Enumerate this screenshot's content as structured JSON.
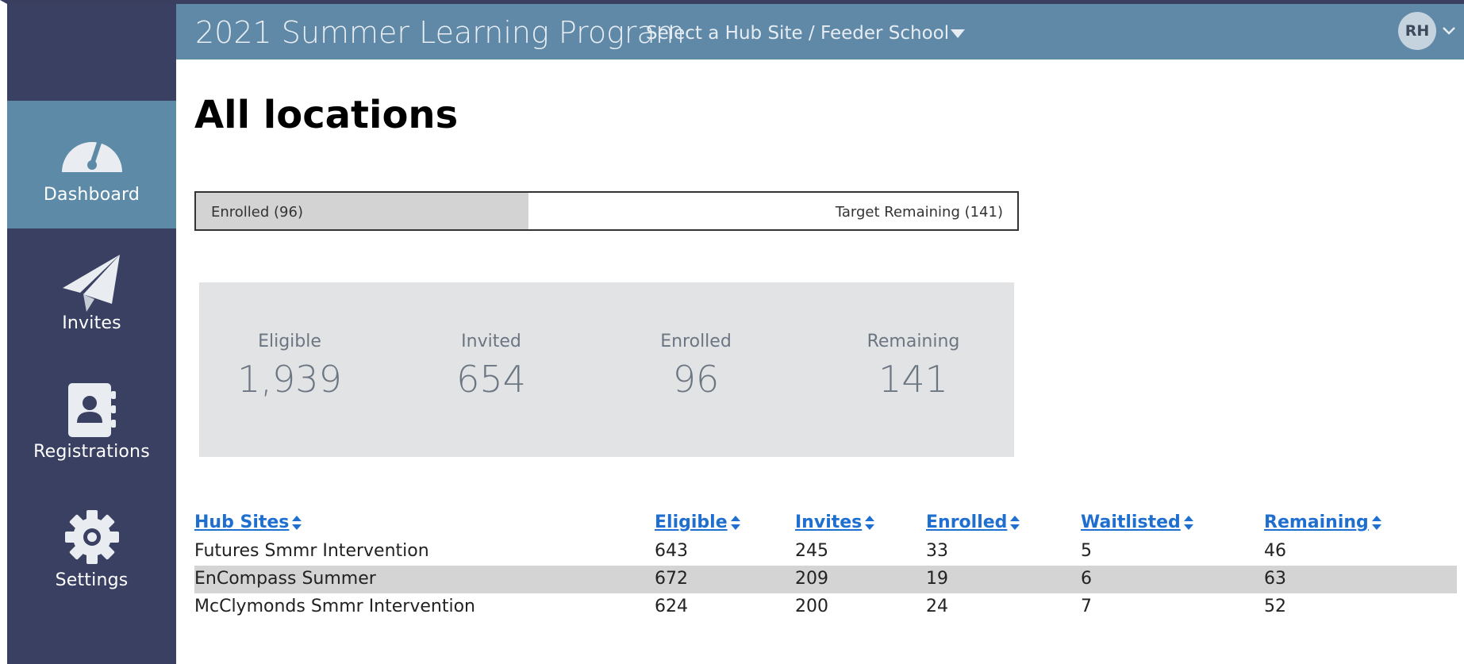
{
  "header": {
    "app_title": "2021 Summer Learning Program",
    "site_select_label": "Select a Hub Site / Feeder School",
    "user_initials": "RH"
  },
  "sidebar": {
    "items": [
      {
        "label": "Dashboard",
        "icon": "speedometer-icon",
        "active": true
      },
      {
        "label": "Invites",
        "icon": "paper-plane-icon",
        "active": false
      },
      {
        "label": "Registrations",
        "icon": "contact-book-icon",
        "active": false
      },
      {
        "label": "Settings",
        "icon": "gear-icon",
        "active": false
      }
    ]
  },
  "main": {
    "page_title": "All locations",
    "progress": {
      "enrolled_label": "Enrolled (96)",
      "remaining_label": "Target Remaining (141)",
      "enrolled_fraction": 0.405
    },
    "stats": [
      {
        "label": "Eligible",
        "value": "1,939"
      },
      {
        "label": "Invited",
        "value": "654"
      },
      {
        "label": "Enrolled",
        "value": "96"
      },
      {
        "label": "Remaining",
        "value": "141"
      }
    ],
    "table": {
      "headers": [
        "Hub Sites",
        "Eligible",
        "Invites",
        "Enrolled",
        "Waitlisted",
        "Remaining"
      ],
      "rows": [
        [
          "Futures Smmr Intervention",
          "643",
          "245",
          "33",
          "5",
          "46"
        ],
        [
          "EnCompass Summer",
          "672",
          "209",
          "19",
          "6",
          "63"
        ],
        [
          "McClymonds Smmr Intervention",
          "624",
          "200",
          "24",
          "7",
          "52"
        ]
      ]
    }
  },
  "colors": {
    "sidebar_bg": "#3a4062",
    "sidebar_active": "#5d8aa6",
    "header_bg": "#6089a8",
    "link": "#1f6fd1",
    "stats_bg": "#e2e3e5"
  }
}
